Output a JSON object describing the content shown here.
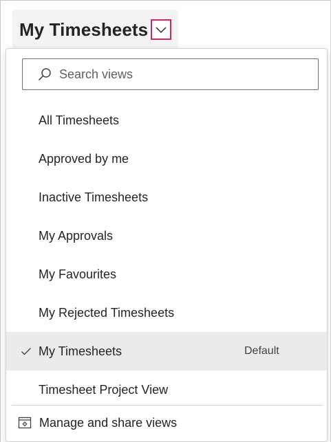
{
  "header": {
    "title": "My Timesheets",
    "chevron_icon": "chevron-down-icon",
    "accent_color": "#d6245f"
  },
  "search": {
    "placeholder": "Search views",
    "value": "",
    "icon": "search-icon"
  },
  "views": [
    {
      "label": "All Timesheets",
      "selected": false,
      "tag": ""
    },
    {
      "label": "Approved by me",
      "selected": false,
      "tag": ""
    },
    {
      "label": "Inactive Timesheets",
      "selected": false,
      "tag": ""
    },
    {
      "label": "My Approvals",
      "selected": false,
      "tag": ""
    },
    {
      "label": "My Favourites",
      "selected": false,
      "tag": ""
    },
    {
      "label": "My Rejected Timesheets",
      "selected": false,
      "tag": ""
    },
    {
      "label": "My Timesheets",
      "selected": true,
      "tag": "Default"
    },
    {
      "label": "Timesheet Project View",
      "selected": false,
      "tag": ""
    }
  ],
  "footer": {
    "manage_label": "Manage and share views",
    "manage_icon": "settings-window-icon"
  }
}
